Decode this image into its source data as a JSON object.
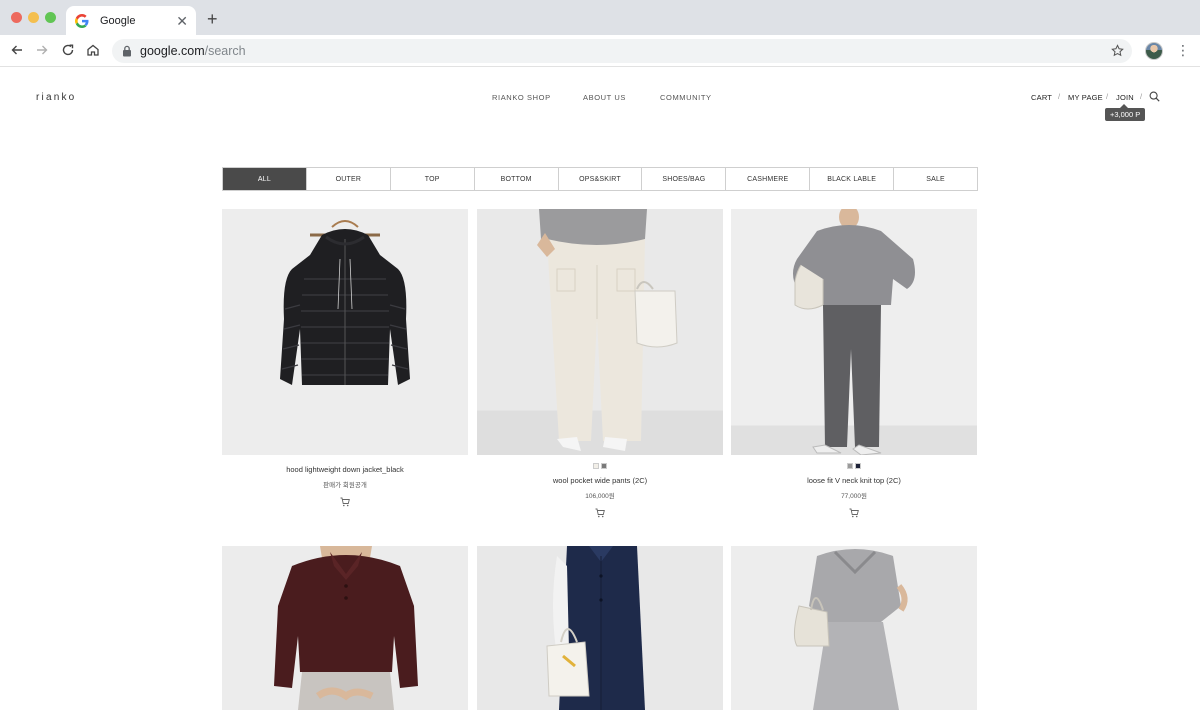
{
  "browser": {
    "tab_title": "Google",
    "url_host": "google.com",
    "url_path": "/search"
  },
  "site": {
    "logo": "rianko",
    "nav": [
      "RIANKO SHOP",
      "ABOUT US",
      "COMMUNITY"
    ],
    "util": {
      "cart": "CART",
      "mypage": "MY PAGE",
      "join": "JOIN",
      "separator": "/",
      "points_badge": "+3,000 P"
    }
  },
  "categories": {
    "active": "ALL",
    "items": [
      "ALL",
      "OUTER",
      "TOP",
      "BOTTOM",
      "OPS&SKIRT",
      "SHOES/BAG",
      "CASHMERE",
      "BLACK LABLE",
      "SALE"
    ]
  },
  "products": [
    {
      "name": "hood lightweight down jacket_black",
      "price": "판매가 회원공개",
      "swatches": []
    },
    {
      "name": "wool pocket wide pants (2C)",
      "price": "106,000원",
      "swatches": [
        "#f2efe8",
        "#7a7a7a"
      ]
    },
    {
      "name": "loose fit V neck knit top (2C)",
      "price": "77,000원",
      "swatches": [
        "#9a9a9a",
        "#1d2238"
      ]
    },
    {
      "name": "",
      "price": "",
      "swatches": []
    },
    {
      "name": "",
      "price": "",
      "swatches": []
    },
    {
      "name": "",
      "price": "",
      "swatches": []
    }
  ],
  "icons": {
    "tab_favicon": "google-g-icon",
    "back": "arrow-left-icon",
    "forward": "arrow-right-icon",
    "reload": "reload-icon",
    "home": "home-icon",
    "lock": "lock-icon",
    "bookmark": "star-icon",
    "menu": "kebab-icon",
    "search": "search-icon",
    "cart": "cart-icon"
  },
  "colors": {
    "active_category_bg": "#4a4a4a",
    "chrome_bg": "#dee1e6",
    "omnibox_bg": "#f1f3f4"
  }
}
